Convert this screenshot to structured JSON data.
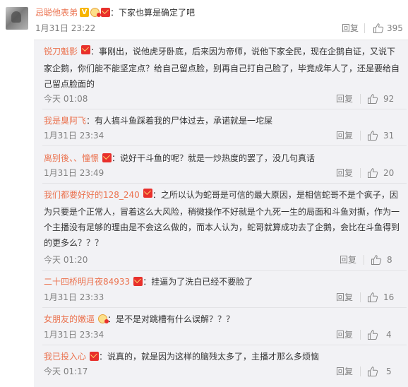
{
  "main": {
    "username": "忌聪他表弟",
    "text": "：下家也算是确定了吧",
    "time": "1月31日 23:22",
    "reply_label": "回复",
    "likes": "395"
  },
  "replies": [
    {
      "username": "锐刀魁影",
      "text": "：事刚出，说他虎牙卧底，后来因为帝师，说他下家全民，现在企鹅自证，又说下家企鹅，你们能不能坚定点？给自己留点脸，别再自己打自己脸了，毕竟成年人了，还是要给自己留点脸面的",
      "time": "今天 01:08",
      "reply_label": "回复",
      "likes": "92"
    },
    {
      "username": "我是臭阿飞",
      "text": "：有人搞斗鱼踩着我的尸体过去，承诺就是一坨屎",
      "time": "1月31日 23:34",
      "reply_label": "回复",
      "likes": "31"
    },
    {
      "username": "离别後、、憧憬",
      "text": "：说好干斗鱼的呢？就是一炒热度的罢了，没几句真话",
      "time": "1月31日 23:49",
      "reply_label": "回复",
      "likes": "20"
    },
    {
      "username": "我们都要好好的128_240",
      "text": "：之所以认为蛇哥是可信的最大原因，是相信蛇哥不是个疯子，因为只要是个正常人，冒着这么大风险，稍微操作不好就是个九死一生的局面和斗鱼对撕，作为一个主播没有足够的理由是不会这么做的，而本人认为，蛇哥就算成功去了企鹅，会比在斗鱼得到的更多么？？？",
      "time": "今天 01:20",
      "reply_label": "回复",
      "likes": "8"
    },
    {
      "username": "二十四桥明月夜84933",
      "text": "：挂逼为了洗白已经不要脸了",
      "time": "1月31日 23:33",
      "reply_label": "回复",
      "likes": "16"
    },
    {
      "username": "女朋友的嫩逼",
      "text": "：是不是对跳槽有什么误解？？？",
      "time": "1月31日 23:34",
      "reply_label": "回复",
      "likes": "4"
    },
    {
      "username": "我已投入心",
      "text": "：说真的，就是因为这样的脑残太多了，主播才那么多烦恼",
      "time": "今天 01:17",
      "reply_label": "回复",
      "likes": "5"
    }
  ],
  "icons": {
    "like": "thumbs-up-icon",
    "vip": "vip-v-icon",
    "badge": "red-envelope-icon"
  }
}
